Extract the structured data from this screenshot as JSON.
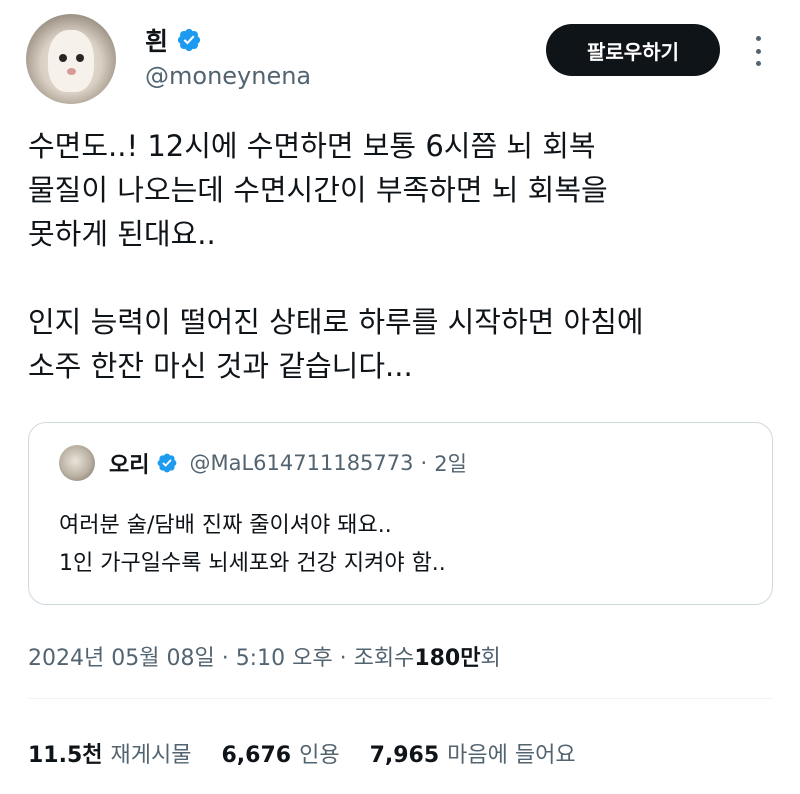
{
  "author": {
    "display_name": "흰",
    "handle": "@moneynena",
    "verified": true
  },
  "follow_button_label": "팔로우하기",
  "more_icon": "more-horizontal-icon",
  "tweet_text": {
    "para1": [
      "수면도..! 12시에 수면하면 보통 6시쯤 뇌 회복",
      "물질이 나오는데 수면시간이 부족하면 뇌 회복을",
      "못하게 된대요.."
    ],
    "para2": [
      "인지 능력이 떨어진 상태로 하루를 시작하면 아침에",
      "소주 한잔 마신 것과 같습니다..."
    ]
  },
  "quoted_tweet": {
    "display_name": "오리",
    "verified": true,
    "handle": "@MaL614711185773",
    "separator": "·",
    "date": "2일",
    "lines": [
      "여러분 술/담배 진짜 줄이셔야 돼요..",
      "1인 가구일수록 뇌세포와 건강 지켜야 함.."
    ]
  },
  "meta": {
    "date": "2024년 05월 08일",
    "separator": "·",
    "time": "5:10 오후",
    "views_label": "조회수",
    "views_value": "180만",
    "views_suffix": "회"
  },
  "stats": {
    "retweets": {
      "count": "11.5천",
      "label": "재게시물"
    },
    "quotes": {
      "count": "6,676",
      "label": "인용"
    },
    "likes": {
      "count": "7,965",
      "label": "마음에 들어요"
    }
  },
  "colors": {
    "text": "#0f1419",
    "secondary": "#536471",
    "verified_blue": "#1d9bf0",
    "border": "#cfd9de",
    "button_bg": "#0f1419"
  }
}
